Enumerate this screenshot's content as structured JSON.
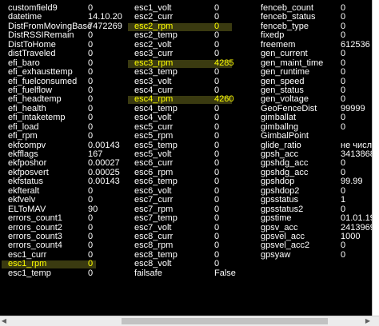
{
  "columns": [
    [
      {
        "name": "customfield9",
        "value": "0"
      },
      {
        "name": "datetime",
        "value": "14.10.20"
      },
      {
        "name": "DistFromMovingBase",
        "value": "7472269"
      },
      {
        "name": "DistRSSIRemain",
        "value": "0"
      },
      {
        "name": "DistToHome",
        "value": "0"
      },
      {
        "name": "distTraveled",
        "value": "0"
      },
      {
        "name": "efi_baro",
        "value": "0"
      },
      {
        "name": "efi_exhausttemp",
        "value": "0"
      },
      {
        "name": "efi_fuelconsumed",
        "value": "0"
      },
      {
        "name": "efi_fuelflow",
        "value": "0"
      },
      {
        "name": "efi_headtemp",
        "value": "0"
      },
      {
        "name": "efi_health",
        "value": "0"
      },
      {
        "name": "efi_intaketemp",
        "value": "0"
      },
      {
        "name": "efi_load",
        "value": "0"
      },
      {
        "name": "efi_rpm",
        "value": "0"
      },
      {
        "name": "ekfcompv",
        "value": "0.00143"
      },
      {
        "name": "ekfflags",
        "value": "167"
      },
      {
        "name": "ekfposhor",
        "value": "0.00027"
      },
      {
        "name": "ekfposvert",
        "value": "0.00025"
      },
      {
        "name": "ekfstatus",
        "value": "0.00143"
      },
      {
        "name": "ekfteralt",
        "value": "0"
      },
      {
        "name": "ekfvelv",
        "value": "0"
      },
      {
        "name": "ELToMAV",
        "value": "90"
      },
      {
        "name": "errors_count1",
        "value": "0"
      },
      {
        "name": "errors_count2",
        "value": "0"
      },
      {
        "name": "errors_count3",
        "value": "0"
      },
      {
        "name": "errors_count4",
        "value": "0"
      },
      {
        "name": "esc1_curr",
        "value": "0"
      },
      {
        "name": "esc1_rpm",
        "value": "0",
        "highlight": true
      },
      {
        "name": "esc1_temp",
        "value": "0"
      }
    ],
    [
      {
        "name": "esc1_volt",
        "value": "0"
      },
      {
        "name": "esc2_curr",
        "value": "0"
      },
      {
        "name": "esc2_rpm",
        "value": "0",
        "highlight": true
      },
      {
        "name": "esc2_temp",
        "value": "0"
      },
      {
        "name": "esc2_volt",
        "value": "0"
      },
      {
        "name": "esc3_curr",
        "value": "0"
      },
      {
        "name": "esc3_rpm",
        "value": "4285",
        "highlight": true
      },
      {
        "name": "esc3_temp",
        "value": "0"
      },
      {
        "name": "esc3_volt",
        "value": "0"
      },
      {
        "name": "esc4_curr",
        "value": "0"
      },
      {
        "name": "esc4_rpm",
        "value": "4260",
        "highlight": true
      },
      {
        "name": "esc4_temp",
        "value": "0"
      },
      {
        "name": "esc4_volt",
        "value": "0"
      },
      {
        "name": "esc5_curr",
        "value": "0"
      },
      {
        "name": "esc5_rpm",
        "value": "0"
      },
      {
        "name": "esc5_temp",
        "value": "0"
      },
      {
        "name": "esc5_volt",
        "value": "0"
      },
      {
        "name": "esc6_curr",
        "value": "0"
      },
      {
        "name": "esc6_rpm",
        "value": "0"
      },
      {
        "name": "esc6_temp",
        "value": "0"
      },
      {
        "name": "esc6_volt",
        "value": "0"
      },
      {
        "name": "esc7_curr",
        "value": "0"
      },
      {
        "name": "esc7_rpm",
        "value": "0"
      },
      {
        "name": "esc7_temp",
        "value": "0"
      },
      {
        "name": "esc7_volt",
        "value": "0"
      },
      {
        "name": "esc8_curr",
        "value": "0"
      },
      {
        "name": "esc8_rpm",
        "value": "0"
      },
      {
        "name": "esc8_temp",
        "value": "0"
      },
      {
        "name": "esc8_volt",
        "value": "0"
      },
      {
        "name": "failsafe",
        "value": "False"
      }
    ],
    [
      {
        "name": "fenceb_count",
        "value": "0"
      },
      {
        "name": "fenceb_status",
        "value": "0"
      },
      {
        "name": "fenceb_type",
        "value": "0"
      },
      {
        "name": "fixedp",
        "value": "0"
      },
      {
        "name": "freemem",
        "value": "612536"
      },
      {
        "name": "gen_current",
        "value": "0"
      },
      {
        "name": "gen_maint_time",
        "value": "0"
      },
      {
        "name": "gen_runtime",
        "value": "0"
      },
      {
        "name": "gen_speed",
        "value": "0"
      },
      {
        "name": "gen_status",
        "value": "0"
      },
      {
        "name": "gen_voltage",
        "value": "0"
      },
      {
        "name": "GeoFenceDist",
        "value": "99999"
      },
      {
        "name": "gimballat",
        "value": "0"
      },
      {
        "name": "gimballng",
        "value": "0"
      },
      {
        "name": "GimbalPoint",
        "value": ""
      },
      {
        "name": "glide_ratio",
        "value": "не числ"
      },
      {
        "name": "gpsh_acc",
        "value": "3413868"
      },
      {
        "name": "gpshdg_acc",
        "value": "0"
      },
      {
        "name": "gpshdg_acc",
        "value": "0"
      },
      {
        "name": "gpshdop",
        "value": "99.99"
      },
      {
        "name": "gpshdop2",
        "value": "0"
      },
      {
        "name": "gpsstatus",
        "value": "1"
      },
      {
        "name": "gpsstatus2",
        "value": "0"
      },
      {
        "name": "gpstime",
        "value": "01.01.19"
      },
      {
        "name": "gpsv_acc",
        "value": "2413969"
      },
      {
        "name": "gpsvel_acc",
        "value": "1000"
      },
      {
        "name": "gpsvel_acc2",
        "value": "0"
      },
      {
        "name": "gpsyaw",
        "value": "0"
      }
    ]
  ],
  "colors": {
    "background": "#000000",
    "text": "#ffffff",
    "highlight_text": "#ffff00",
    "highlight_band": "#3a3a10"
  },
  "scrollbar": {
    "left_arrow": "◀",
    "right_arrow": "▶"
  }
}
